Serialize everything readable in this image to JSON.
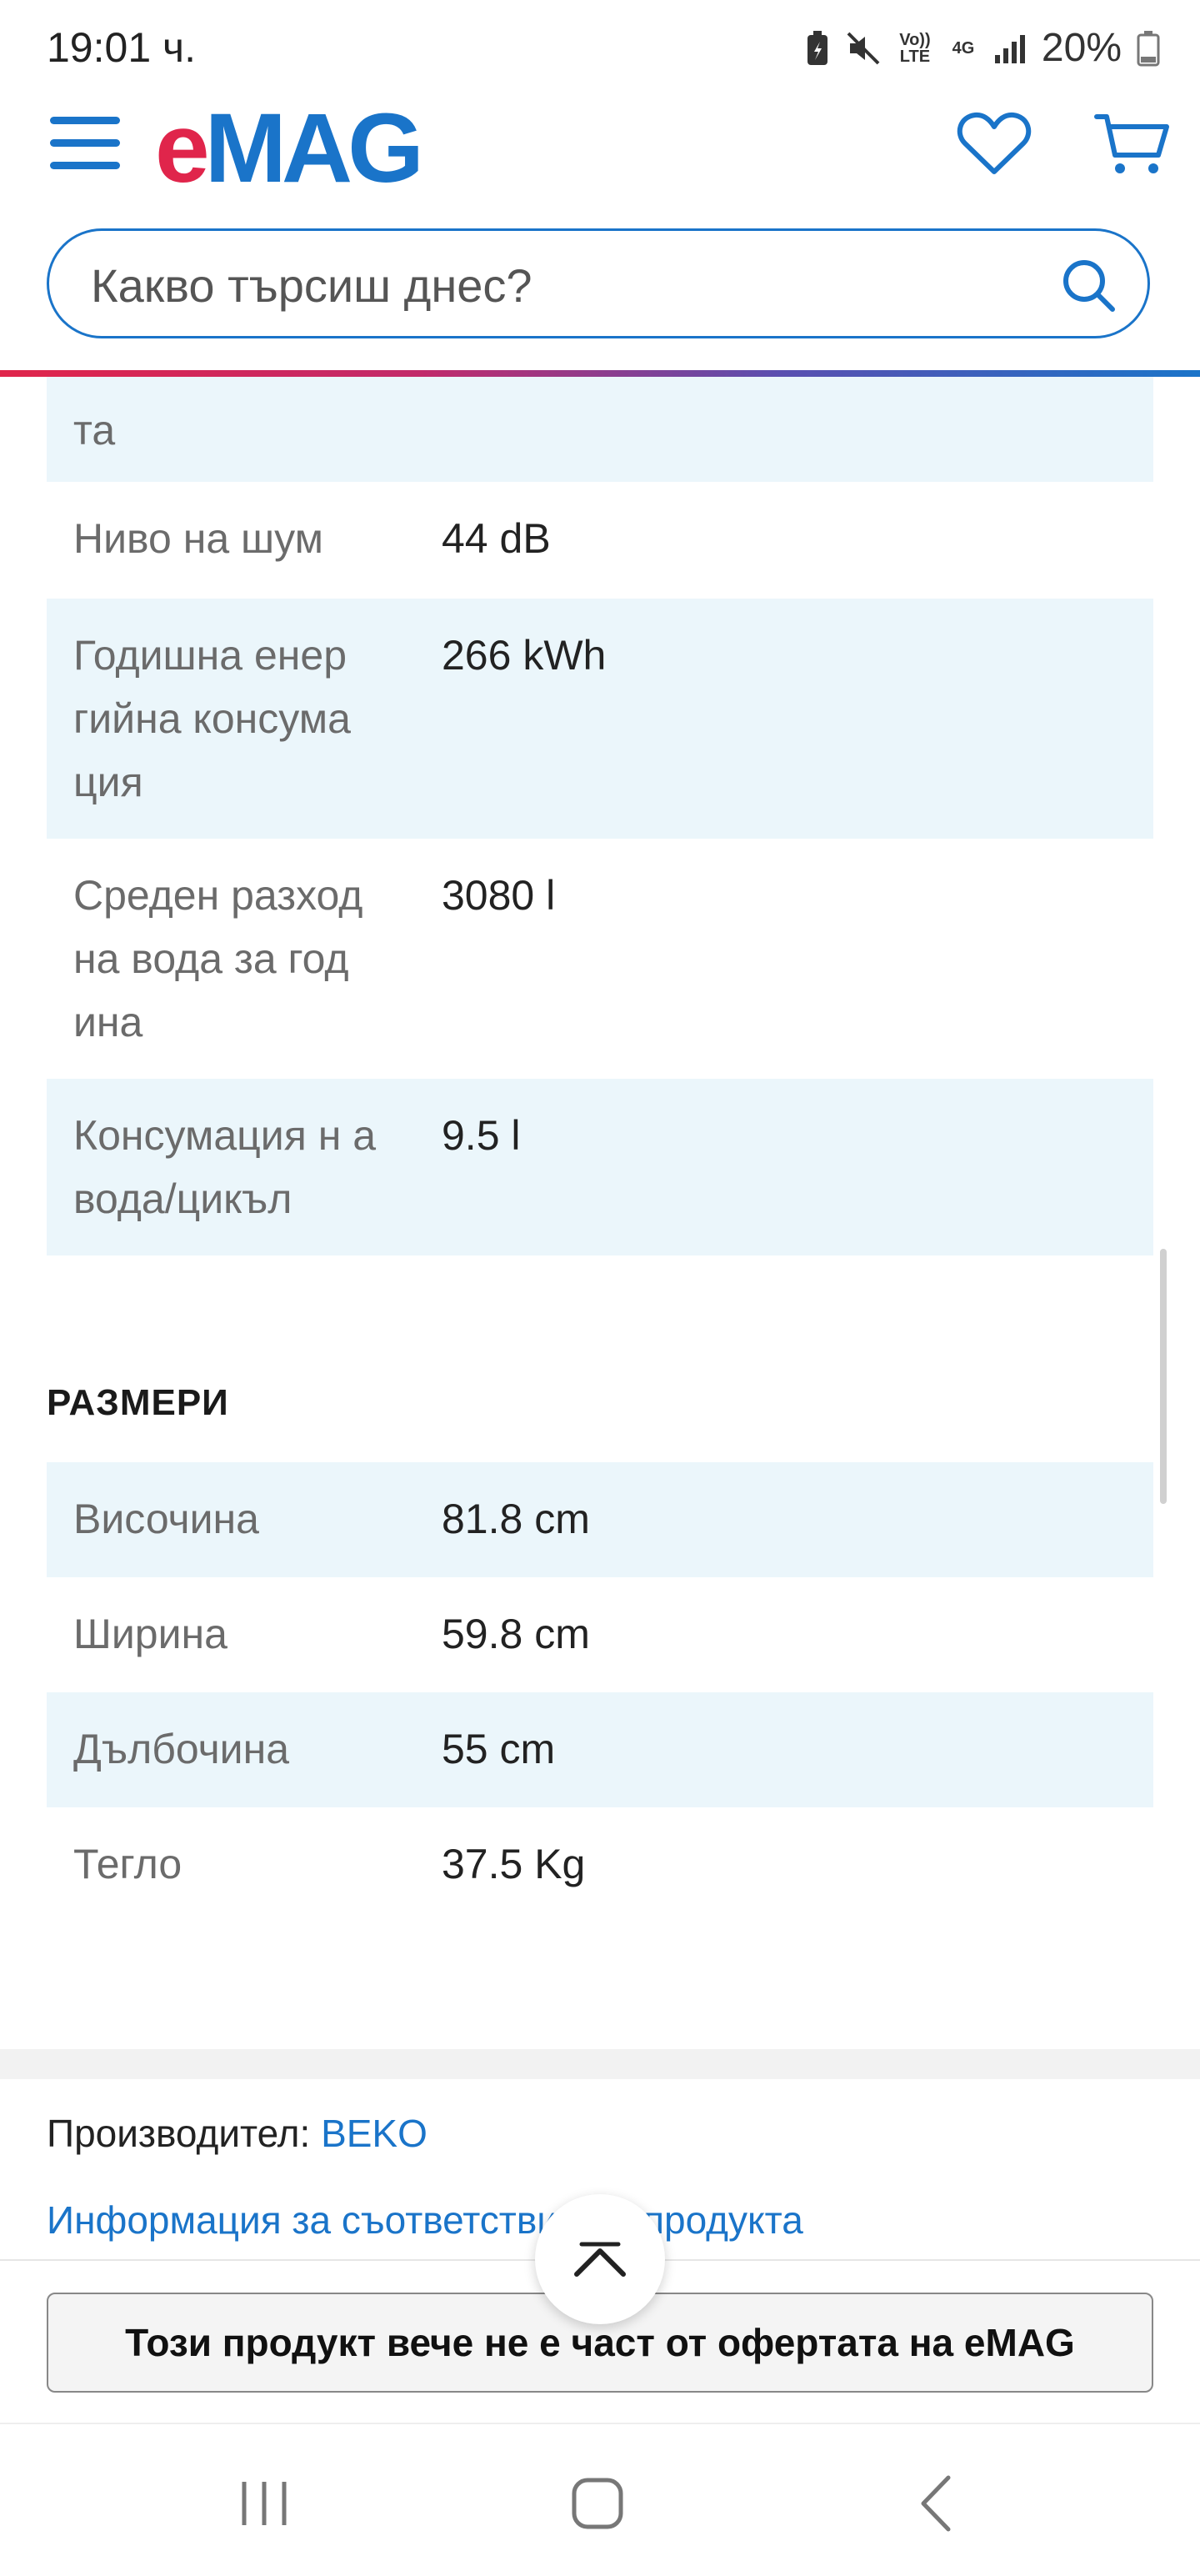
{
  "status_bar": {
    "time": "19:01 ч.",
    "battery": "20%",
    "volte": "Vo)) LTE",
    "network": "4G"
  },
  "header": {
    "logo_e": "e",
    "logo_mag": "MAG",
    "search_placeholder": "Какво търсиш днес?"
  },
  "specs_top": [
    {
      "key": "та",
      "value": ""
    },
    {
      "key": "Ниво на шум",
      "value": "44 dB"
    },
    {
      "key": "Годишна енер гийна консума ция",
      "value": "266 kWh"
    },
    {
      "key": "Среден разход на вода за год ина",
      "value": "3080 l"
    },
    {
      "key": "Консумация н а вода/цикъл",
      "value": "9.5 l"
    }
  ],
  "dimensions": {
    "title": "РАЗМЕРИ",
    "rows": [
      {
        "key": "Височина",
        "value": "81.8 cm"
      },
      {
        "key": "Ширина",
        "value": "59.8 cm"
      },
      {
        "key": "Дълбочина",
        "value": "55 cm"
      },
      {
        "key": "Тегло",
        "value": "37.5 Kg"
      }
    ]
  },
  "footer_info": {
    "manufacturer_label": "Производител:",
    "manufacturer_name": "BEKO",
    "conformity_link": "Информация за съответствие на продукта"
  },
  "bottom": {
    "unavailable_text": "Този продукт вече не е част от офертата на eMAG"
  },
  "colors": {
    "brand_blue": "#1a74c9",
    "brand_red": "#e0254b",
    "row_shade": "#ebf6fb"
  },
  "icons": [
    "hamburger-menu-icon",
    "heart-icon",
    "cart-icon",
    "search-icon",
    "chevron-up-icon",
    "recent-apps-icon",
    "home-icon",
    "back-icon"
  ]
}
